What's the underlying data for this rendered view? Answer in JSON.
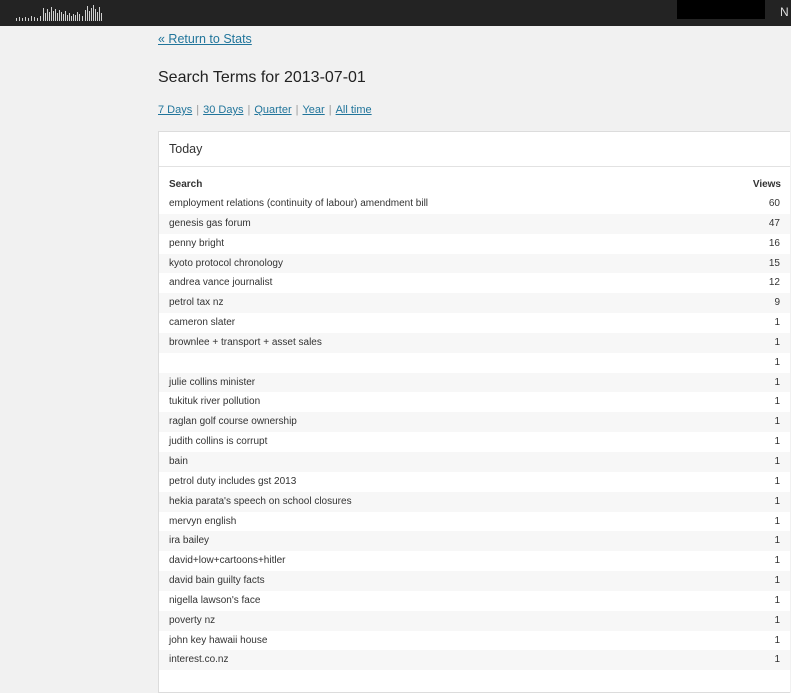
{
  "topbar": {
    "user_initial": "N"
  },
  "nav": {
    "back_label": "« Return to Stats"
  },
  "page": {
    "title": "Search Terms for 2013-07-01"
  },
  "periods": [
    {
      "label": "7 Days"
    },
    {
      "label": "30 Days"
    },
    {
      "label": "Quarter"
    },
    {
      "label": "Year"
    },
    {
      "label": "All time"
    }
  ],
  "panel": {
    "title": "Today",
    "col_search": "Search",
    "col_views": "Views"
  },
  "rows": [
    {
      "term": "employment relations (continuity of labour) amendment bill",
      "views": "60"
    },
    {
      "term": "genesis gas forum",
      "views": "47"
    },
    {
      "term": "penny bright",
      "views": "16"
    },
    {
      "term": "kyoto protocol chronology",
      "views": "15"
    },
    {
      "term": "andrea vance journalist",
      "views": "12"
    },
    {
      "term": "petrol tax nz",
      "views": "9"
    },
    {
      "term": "cameron slater",
      "views": "1"
    },
    {
      "term": "brownlee + transport + asset sales",
      "views": "1"
    },
    {
      "term": "",
      "views": "1",
      "redacted": true
    },
    {
      "term": "julie collins minister",
      "views": "1"
    },
    {
      "term": "tukituk river pollution",
      "views": "1"
    },
    {
      "term": "raglan golf course ownership",
      "views": "1"
    },
    {
      "term": "judith collins is corrupt",
      "views": "1"
    },
    {
      "term": "bain",
      "views": "1"
    },
    {
      "term": "petrol duty includes gst 2013",
      "views": "1"
    },
    {
      "term": "hekia parata's speech on school closures",
      "views": "1"
    },
    {
      "term": "mervyn english",
      "views": "1"
    },
    {
      "term": "ira bailey",
      "views": "1"
    },
    {
      "term": "david+low+cartoons+hitler",
      "views": "1"
    },
    {
      "term": "david bain guilty facts",
      "views": "1"
    },
    {
      "term": "nigella lawson's face",
      "views": "1"
    },
    {
      "term": "poverty nz",
      "views": "1"
    },
    {
      "term": "john key hawaii house",
      "views": "1"
    },
    {
      "term": "interest.co.nz",
      "views": "1"
    }
  ]
}
